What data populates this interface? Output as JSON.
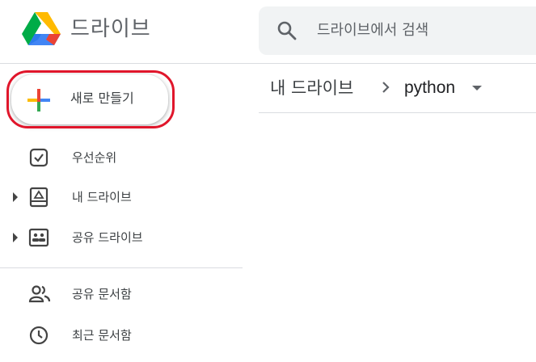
{
  "app": {
    "title": "드라이브"
  },
  "search": {
    "placeholder": "드라이브에서 검색"
  },
  "sidebar": {
    "new_button": {
      "label": "새로 만들기"
    },
    "items": [
      {
        "label": "우선순위",
        "icon": "priority-check-icon"
      },
      {
        "label": "내 드라이브",
        "icon": "my-drive-icon"
      },
      {
        "label": "공유 드라이브",
        "icon": "shared-drive-icon"
      },
      {
        "label": "공유 문서함",
        "icon": "people-icon"
      },
      {
        "label": "최근 문서함",
        "icon": "clock-icon"
      }
    ]
  },
  "breadcrumb": {
    "root": "내 드라이브",
    "current": "python"
  },
  "colors": {
    "accent_red": "#e0162b",
    "text": "#3c4043",
    "search_bg": "#f1f3f4",
    "divider": "#dadce0"
  }
}
